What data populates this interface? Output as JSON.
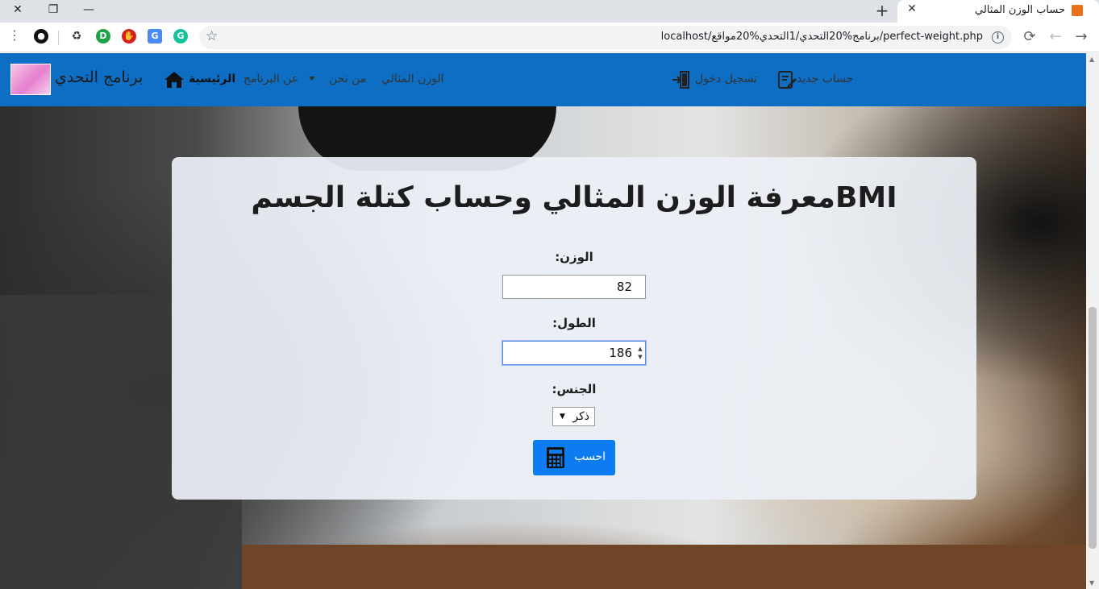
{
  "browser": {
    "tab_title": "حساب الوزن المثالي",
    "url": "localhost/برنامج%20التحدي/1التحدي%20مواقع/perfect-weight.php",
    "icons": [
      "back-arrow-icon",
      "forward-arrow-icon",
      "reload-icon",
      "info-icon",
      "star-icon",
      "menu-kebab-icon"
    ]
  },
  "navbar": {
    "brand": "برنامج التحدي",
    "links": {
      "home": "الرئيسية",
      "about": "عن البرنامج",
      "who": "من نحن",
      "ideal": "الوزن المثالي",
      "login": "تسجيل دخول",
      "signup": "حساب جديد"
    },
    "color": "#0d6ec4"
  },
  "form": {
    "title": "معرفة الوزن المثالي وحساب كتلة الجسمBMI",
    "weight_label": "الوزن:",
    "weight_value": "82",
    "height_label": "الطول:",
    "height_value": "186",
    "gender_label": "الجنس:",
    "gender_value": "ذكر",
    "submit_label": "احسب",
    "submit_color": "#0d7bf2"
  }
}
